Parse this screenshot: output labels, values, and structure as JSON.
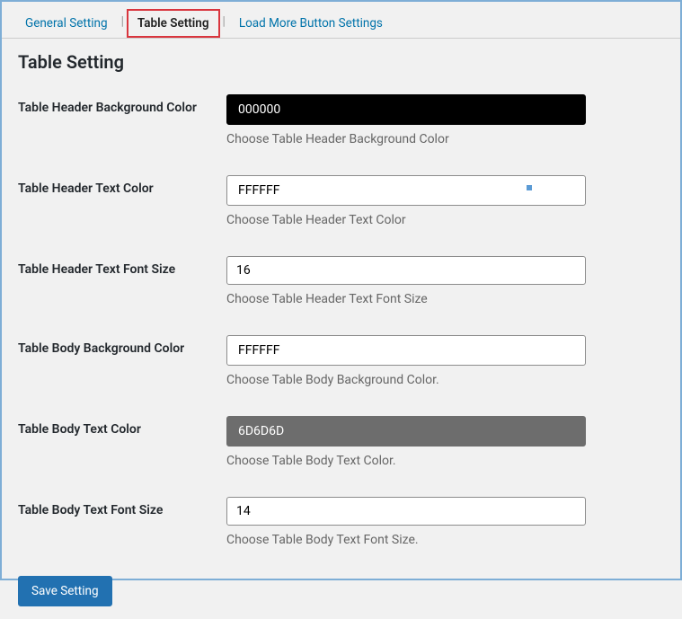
{
  "tabs": {
    "general": "General Setting",
    "table": "Table Setting",
    "loadmore": "Load More Button Settings"
  },
  "heading": "Table Setting",
  "fields": {
    "header_bg": {
      "label": "Table Header Background Color",
      "value": "000000",
      "helper": "Choose Table Header Background Color"
    },
    "header_text": {
      "label": "Table Header Text Color",
      "value": "FFFFFF",
      "helper": "Choose Table Header Text Color"
    },
    "header_size": {
      "label": "Table Header Text Font Size",
      "value": "16",
      "helper": "Choose Table Header Text Font Size"
    },
    "body_bg": {
      "label": "Table Body Background Color",
      "value": "FFFFFF",
      "helper": "Choose Table Body Background Color."
    },
    "body_text": {
      "label": "Table Body Text Color",
      "value": "6D6D6D",
      "helper": "Choose Table Body Text Color."
    },
    "body_size": {
      "label": "Table Body Text Font Size",
      "value": "14",
      "helper": "Choose Table Body Text Font Size."
    }
  },
  "save_label": "Save Setting"
}
